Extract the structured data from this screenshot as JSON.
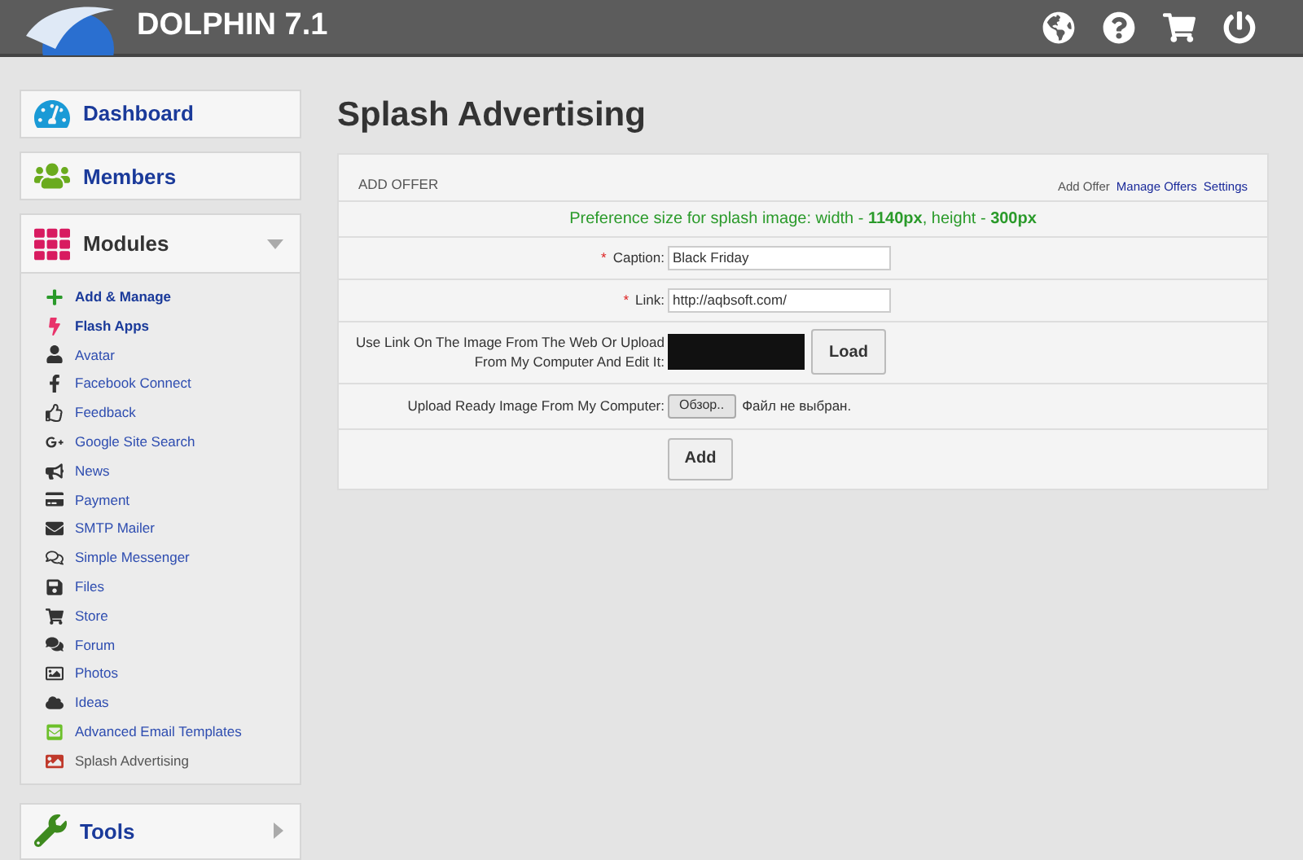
{
  "header": {
    "title": "DOLPHIN 7.1"
  },
  "sidebar": {
    "cards": [
      {
        "label": "Dashboard"
      },
      {
        "label": "Members"
      }
    ],
    "modules": {
      "label": "Modules",
      "expanded": true,
      "items": [
        {
          "label": "Add & Manage",
          "kind": "bold"
        },
        {
          "label": "Flash Apps",
          "kind": "bold"
        },
        {
          "label": "Avatar",
          "kind": "normal"
        },
        {
          "label": "Facebook Connect",
          "kind": "normal"
        },
        {
          "label": "Feedback",
          "kind": "normal"
        },
        {
          "label": "Google Site Search",
          "kind": "normal"
        },
        {
          "label": "News",
          "kind": "normal"
        },
        {
          "label": "Payment",
          "kind": "normal"
        },
        {
          "label": "SMTP Mailer",
          "kind": "normal"
        },
        {
          "label": "Simple Messenger",
          "kind": "normal"
        },
        {
          "label": "Files",
          "kind": "normal"
        },
        {
          "label": "Store",
          "kind": "normal"
        },
        {
          "label": "Forum",
          "kind": "normal"
        },
        {
          "label": "Photos",
          "kind": "normal"
        },
        {
          "label": "Ideas",
          "kind": "normal"
        },
        {
          "label": "Advanced Email Templates",
          "kind": "normal"
        },
        {
          "label": "Splash Advertising",
          "kind": "current"
        }
      ]
    },
    "tools": {
      "label": "Tools",
      "expanded": false
    }
  },
  "page": {
    "title": "Splash Advertising"
  },
  "panel": {
    "title": "ADD OFFER",
    "links": [
      {
        "label": "Add Offer",
        "selected": true
      },
      {
        "label": "Manage Offers",
        "selected": false
      },
      {
        "label": "Settings",
        "selected": false
      }
    ],
    "notice": "Preference size for splash image: width - **1140px**, height - **300px**",
    "rows": [
      {
        "kind": "text",
        "label": "Caption:",
        "marker": "*",
        "value": "Black Friday"
      },
      {
        "kind": "text",
        "label": "Link:",
        "marker": "*",
        "value": "http://aqbsoft.com/"
      },
      {
        "kind": "image",
        "label": "Use Link On The Image From The Web Or Upload From My Computer And Edit It:",
        "button": "Load"
      },
      {
        "kind": "file",
        "label": "Upload Ready Image From My Computer:",
        "button": "Обзор..",
        "status": "Файл не выбран."
      },
      {
        "kind": "submit",
        "button": "Add"
      }
    ]
  }
}
